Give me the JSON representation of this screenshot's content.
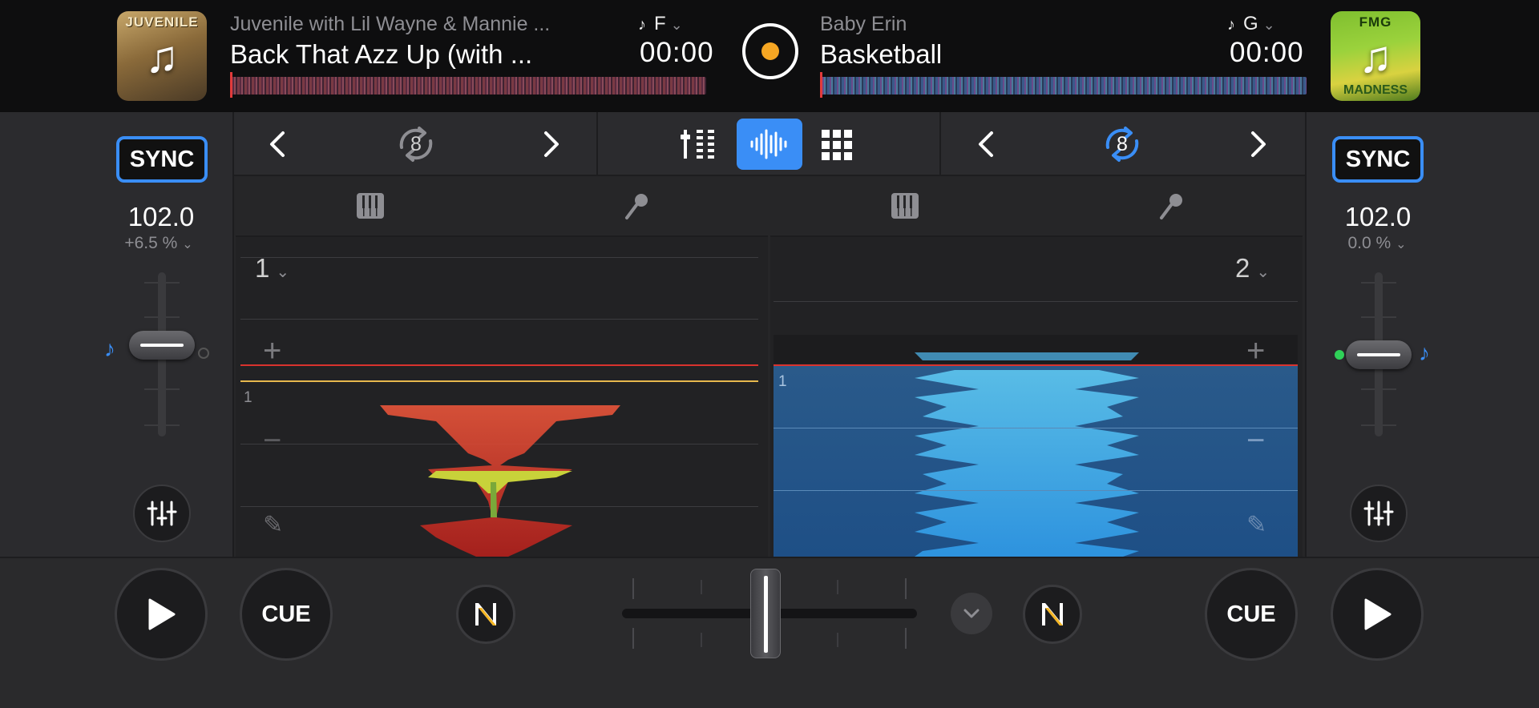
{
  "deck_a": {
    "artist": "Juvenile with Lil Wayne & Mannie ...",
    "title": "Back That Azz Up (with ...",
    "key": "F",
    "time": "00:00",
    "cover_text": "JUVENILE",
    "sync_label": "SYNC",
    "bpm": "102.0",
    "pitch": "+6.5 %",
    "loop_beats": "8",
    "cue_number": "1",
    "pad_label": "1",
    "cue_label": "CUE"
  },
  "deck_b": {
    "artist": "Baby Erin",
    "title": "Basketball",
    "key": "G",
    "time": "00:00",
    "cover_text": "FMG",
    "cover_text2": "MADNESS",
    "sync_label": "SYNC",
    "bpm": "102.0",
    "pitch": "0.0 %",
    "loop_beats": "8",
    "cue_number": "2",
    "pad_label": "1",
    "cue_label": "CUE"
  },
  "colors": {
    "accent": "#3a8ef6",
    "deck_a_wave": "#d9332e",
    "deck_b_wave": "#2f9ae8",
    "center_dot": "#f5a623"
  },
  "icons": {
    "music_note": "music-note-icon",
    "loop": "loop-icon",
    "mixer": "mixer-icon",
    "waveform": "waveform-icon",
    "pads": "pads-grid-icon",
    "keyboard": "keyboard-icon",
    "microphone": "microphone-icon",
    "eq": "eq-sliders-icon",
    "play": "play-icon",
    "neural_mix": "neural-mix-icon"
  },
  "crossfader_position": 0.5
}
